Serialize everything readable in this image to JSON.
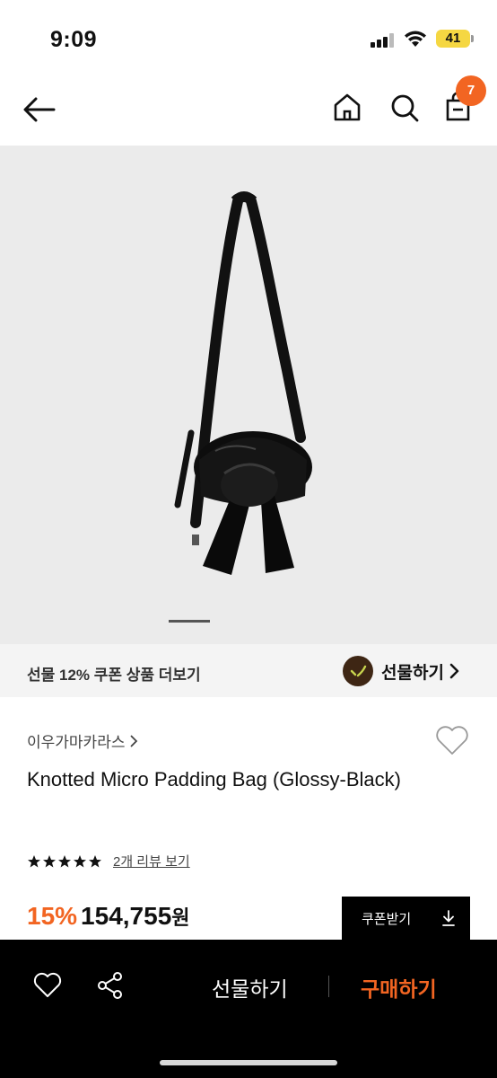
{
  "status_bar": {
    "time": "9:09",
    "battery": "41"
  },
  "header": {
    "cart_count": "7",
    "icons": [
      "back-arrow-icon",
      "home-icon",
      "search-icon",
      "cart-icon"
    ]
  },
  "gift_bar": {
    "text": "선물 12% 쿠폰 상품 더보기",
    "link_label": "선물하기"
  },
  "product": {
    "brand": "이우가마카라스",
    "title": "Knotted Micro Padding Bag (Glossy-Black)",
    "rating_stars": 5,
    "review_link": "2개 리뷰 보기",
    "discount": "15%",
    "price": "154,755",
    "price_unit": "원",
    "coupon_button": "쿠폰받기"
  },
  "bottom_bar": {
    "gift_label": "선물하기",
    "buy_label": "구매하기"
  },
  "colors": {
    "accent": "#f26522",
    "image_bg": "#ebebeb",
    "bar_bg": "#000000"
  }
}
